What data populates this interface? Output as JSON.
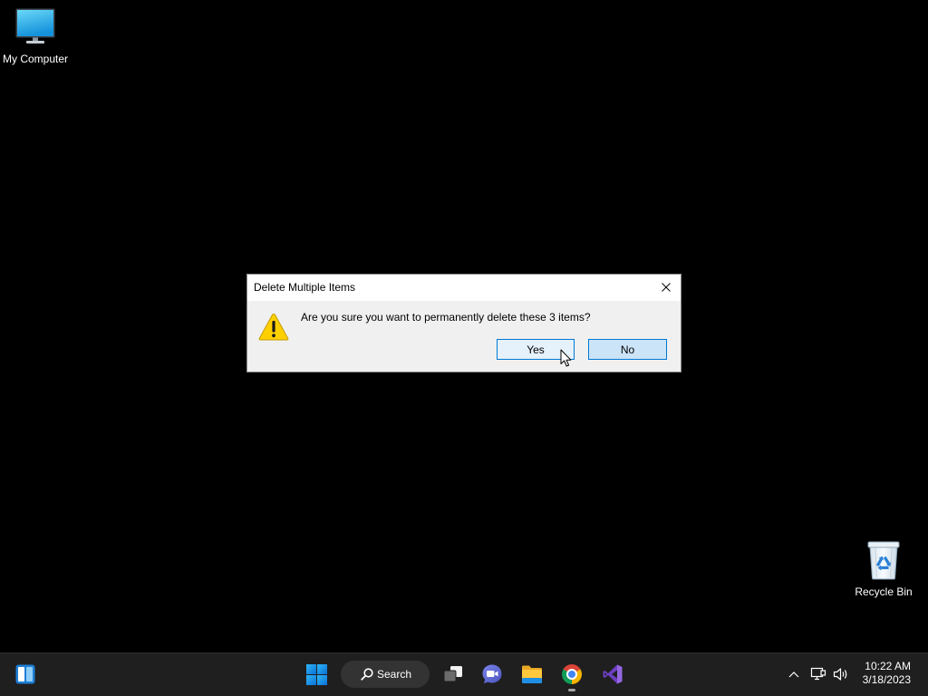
{
  "colors": {
    "desktop_background": "#000000",
    "taskbar_background": "#1f1f1f",
    "accent": "#0078d4",
    "dialog_titlebar": "#ffffff",
    "dialog_body": "#f0f0f0"
  },
  "desktop": {
    "icons": [
      {
        "label": "My Computer",
        "icon": "monitor-icon"
      },
      {
        "label": "Recycle Bin",
        "icon": "recycle-bin-icon"
      }
    ]
  },
  "dialog": {
    "title": "Delete Multiple Items",
    "close_icon": "close-icon",
    "icon": "warning-icon",
    "message": "Are you sure you want to permanently delete these 3 items?",
    "buttons": {
      "yes": {
        "label": "Yes",
        "hovered": true
      },
      "no": {
        "label": "No",
        "focused": true
      }
    }
  },
  "taskbar": {
    "widgets": {
      "icon": "widgets-icon"
    },
    "start": {
      "icon": "windows-start-icon"
    },
    "search": {
      "icon": "search-icon",
      "label": "Search"
    },
    "pinned_apps": [
      {
        "icon": "task-view-icon",
        "running": false
      },
      {
        "icon": "teams-chat-icon",
        "running": false
      },
      {
        "icon": "file-explorer-icon",
        "running": false
      },
      {
        "icon": "chrome-icon",
        "running": true
      },
      {
        "icon": "visual-studio-icon",
        "running": false
      }
    ],
    "tray": {
      "icons": [
        "chevron-up-icon",
        "network-icon",
        "volume-icon"
      ],
      "time": "10:22 AM",
      "date": "3/18/2023"
    }
  }
}
